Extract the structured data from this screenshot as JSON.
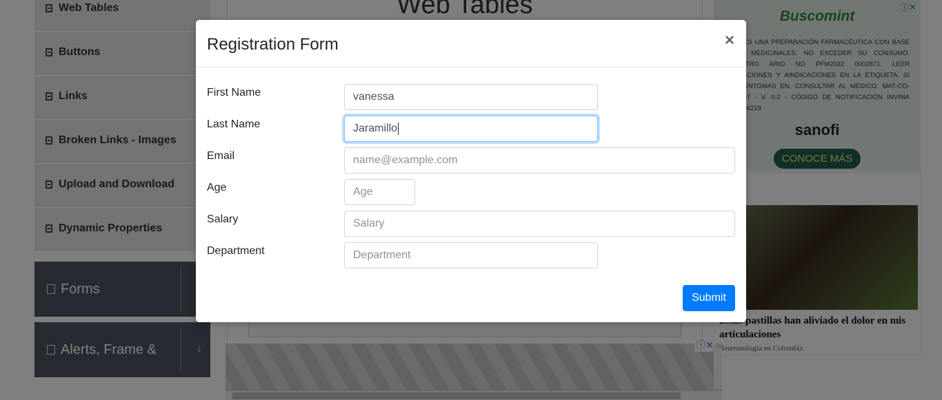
{
  "sidebar": {
    "items": [
      {
        "label": "Web Tables"
      },
      {
        "label": "Buttons"
      },
      {
        "label": "Links"
      },
      {
        "label": "Broken Links - Images"
      },
      {
        "label": "Upload and Download"
      },
      {
        "label": "Dynamic Properties"
      }
    ],
    "groups": [
      {
        "label": "Forms"
      },
      {
        "label": "Alerts, Frame &"
      }
    ]
  },
  "background": {
    "page_title": "Web Tables"
  },
  "ads": {
    "right_brand": "Buscomint",
    "right_text": "MINT ES UNA PREPARACIÓN FARMACÉUTICA CON BASE EN S MEDICINALES. NO EXCEDER SU CONSUMO. REGISTRO ARIO NO PFM2022 0002871. LEER INDICACIONES Y AINDICACIONES EN LA ETIQUETA. SI LOS SÍNTOMAS EN, CONSULTAR AL MÉDICO. MAT-CO-2402507 - V. 0.2 - CÓDIGO DE NOTIFICACIÓN INVIMA 2024006219",
    "right_logo": "sanofi",
    "right_button": "CONOCE MÁS",
    "caption": "Estas pastillas han aliviado el dolor en mis articulaciones",
    "source": "Reumatología en Colombia"
  },
  "modal": {
    "title": "Registration Form",
    "close_label": "×",
    "fields": [
      {
        "label": "First Name",
        "value": "vanessa",
        "placeholder": ""
      },
      {
        "label": "Last Name",
        "value": "Jaramillo",
        "placeholder": ""
      },
      {
        "label": "Email",
        "value": "",
        "placeholder": "name@example.com"
      },
      {
        "label": "Age",
        "value": "",
        "placeholder": "Age"
      },
      {
        "label": "Salary",
        "value": "",
        "placeholder": "Salary"
      },
      {
        "label": "Department",
        "value": "",
        "placeholder": "Department"
      }
    ],
    "submit_label": "Submit"
  }
}
